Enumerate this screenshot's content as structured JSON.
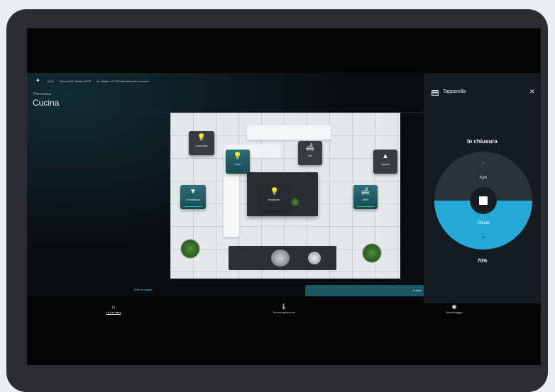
{
  "topbar": {
    "time": "13:21",
    "date": "Giovedì 16 Ottobre 2025",
    "weather": "Milano 24° Prevalentemente nuvoloso"
  },
  "header": {
    "floor": "Piano terra",
    "room": "Cucina"
  },
  "map": {
    "tiles": [
      {
        "label": "Luce letto",
        "icon": "bulb-icon"
      },
      {
        "label": "Luce",
        "icon": "bulb-icon"
      },
      {
        "label": "0%",
        "icon": "lamp-icon"
      },
      {
        "label": "Aperta",
        "icon": "blind-icon"
      },
      {
        "label": "In chiusura",
        "icon": "blind-icon"
      },
      {
        "label": "Temporiz...",
        "icon": "bulb-icon"
      },
      {
        "label": "80%",
        "icon": "lamp-icon"
      }
    ]
  },
  "map_tabs": {
    "all_maps": "Tutte le mappe",
    "current": "Cucina"
  },
  "bottom_nav": [
    {
      "label": "La tua casa",
      "icon": "home-icon"
    },
    {
      "label": "Termoregolazione",
      "icon": "thermometer-icon"
    },
    {
      "label": "Monitoraggio",
      "icon": "eye-icon"
    }
  ],
  "panel": {
    "title": "Tapparella",
    "status": "In chiusura",
    "open_label": "Apri",
    "close_label": "Chiudi",
    "position_percent": "70%",
    "accent_color": "#24a9d8"
  }
}
